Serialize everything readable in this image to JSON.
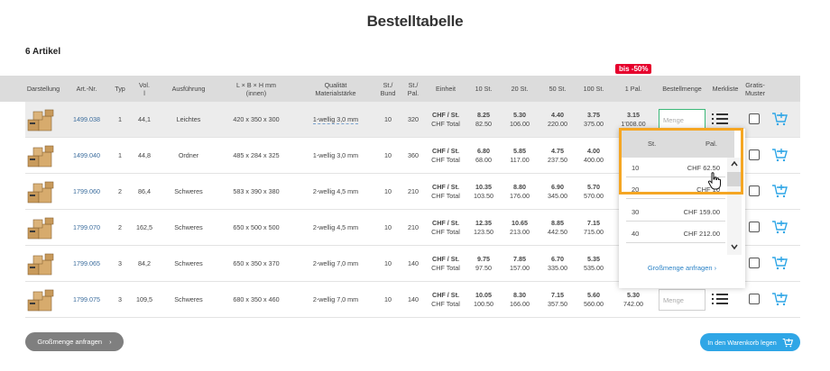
{
  "page": {
    "title": "Bestelltabelle",
    "count": "6 Artikel",
    "badge": "bis -50%"
  },
  "columns": {
    "darstellung": "Darstellung",
    "artnr": "Art.-Nr.",
    "typ": "Typ",
    "vol": "Vol.\nl",
    "ausfuehrung": "Ausführung",
    "masse": "L × B × H mm\n(innen)",
    "qualitaet": "Qualität\nMaterialstärke",
    "bund": "St./\nBund",
    "pal": "St./\nPal.",
    "einheit": "Einheit",
    "p10": "10 St.",
    "p20": "20 St.",
    "p50": "50 St.",
    "p100": "100 St.",
    "p1pal": "1 Pal.",
    "bestellmenge": "Bestellmenge",
    "merkliste": "Merkliste",
    "gratis": "Gratis-\nMuster"
  },
  "unit_labels": {
    "st": "CHF / St.",
    "total": "CHF Total"
  },
  "menge_placeholder": "Menge",
  "rows": [
    {
      "artnr": "1499.038",
      "typ": "1",
      "vol": "44,1",
      "ausf": "Leichtes",
      "masse": "420 x 350 x 300",
      "qual": "1-wellig 3,0 mm",
      "bund": "10",
      "pal": "320",
      "p10": [
        "8.25",
        "82.50"
      ],
      "p20": [
        "5.30",
        "106.00"
      ],
      "p50": [
        "4.40",
        "220.00"
      ],
      "p100": [
        "3.75",
        "375.00"
      ],
      "p1pal": [
        "3.15",
        "1'008.00"
      ]
    },
    {
      "artnr": "1499.040",
      "typ": "1",
      "vol": "44,8",
      "ausf": "Ordner",
      "masse": "485 x 284 x 325",
      "qual": "1-wellig 3,0 mm",
      "bund": "10",
      "pal": "360",
      "p10": [
        "6.80",
        "68.00"
      ],
      "p20": [
        "5.85",
        "117.00"
      ],
      "p50": [
        "4.75",
        "237.50"
      ],
      "p100": [
        "4.00",
        "400.00"
      ],
      "p1pal": [
        "",
        ""
      ]
    },
    {
      "artnr": "1799.060",
      "typ": "2",
      "vol": "86,4",
      "ausf": "Schweres",
      "masse": "583 x 390 x 380",
      "qual": "2-wellig 4,5 mm",
      "bund": "10",
      "pal": "210",
      "p10": [
        "10.35",
        "103.50"
      ],
      "p20": [
        "8.80",
        "176.00"
      ],
      "p50": [
        "6.90",
        "345.00"
      ],
      "p100": [
        "5.70",
        "570.00"
      ],
      "p1pal": [
        "",
        ""
      ]
    },
    {
      "artnr": "1799.070",
      "typ": "2",
      "vol": "162,5",
      "ausf": "Schweres",
      "masse": "650 x 500 x 500",
      "qual": "2-wellig 4,5 mm",
      "bund": "10",
      "pal": "210",
      "p10": [
        "12.35",
        "123.50"
      ],
      "p20": [
        "10.65",
        "213.00"
      ],
      "p50": [
        "8.85",
        "442.50"
      ],
      "p100": [
        "7.15",
        "715.00"
      ],
      "p1pal": [
        "",
        ""
      ]
    },
    {
      "artnr": "1799.065",
      "typ": "3",
      "vol": "84,2",
      "ausf": "Schweres",
      "masse": "650 x 350 x 370",
      "qual": "2-wellig 7,0 mm",
      "bund": "10",
      "pal": "140",
      "p10": [
        "9.75",
        "97.50"
      ],
      "p20": [
        "7.85",
        "157.00"
      ],
      "p50": [
        "6.70",
        "335.00"
      ],
      "p100": [
        "5.35",
        "535.00"
      ],
      "p1pal": [
        "",
        ""
      ]
    },
    {
      "artnr": "1799.075",
      "typ": "3",
      "vol": "109,5",
      "ausf": "Schweres",
      "masse": "680 x 350 x 460",
      "qual": "2-wellig 7,0 mm",
      "bund": "10",
      "pal": "140",
      "p10": [
        "10.05",
        "100.50"
      ],
      "p20": [
        "8.30",
        "166.00"
      ],
      "p50": [
        "7.15",
        "357.50"
      ],
      "p100": [
        "5.60",
        "560.00"
      ],
      "p1pal": [
        "5.30",
        "742.00"
      ]
    }
  ],
  "popup": {
    "head_st": "St.",
    "head_pal": "Pal.",
    "items": [
      {
        "q": "10",
        "p": "CHF 62.50"
      },
      {
        "q": "20",
        "p": "CHF 10"
      },
      {
        "q": "30",
        "p": "CHF 159.00"
      },
      {
        "q": "40",
        "p": "CHF 212.00"
      }
    ],
    "link": "Großmenge anfragen"
  },
  "buttons": {
    "grossmenge": "Großmenge anfragen",
    "warenkorb": "In den Warenkorb legen"
  },
  "colors": {
    "accent_blue": "#2fa6e6",
    "badge_red": "#e6002d",
    "highlight_orange": "#f5a623",
    "active_green": "#3cb878"
  }
}
